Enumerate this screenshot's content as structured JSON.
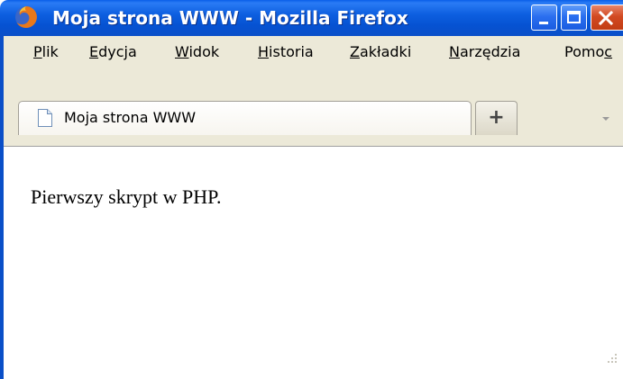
{
  "window": {
    "title": "Moja strona WWW - Mozilla Firefox"
  },
  "title_buttons": {
    "minimize": "minimize-icon",
    "maximize": "maximize-icon",
    "close": "close-icon"
  },
  "menu": {
    "items": [
      {
        "underline": "P",
        "rest": "lik"
      },
      {
        "underline": "E",
        "rest": "dycja"
      },
      {
        "underline": "W",
        "rest": "idok"
      },
      {
        "underline": "H",
        "rest": "istoria"
      },
      {
        "underline": "Z",
        "rest": "akładki"
      },
      {
        "underline": "N",
        "rest": "arzędzia"
      },
      {
        "prefix": "Pomo",
        "underline": "c"
      }
    ]
  },
  "tabs": {
    "active_label": "Moja strona WWW",
    "new_tab_label": "+"
  },
  "page": {
    "text": "Pierwszy skrypt w PHP."
  },
  "colors": {
    "titlebar": "#0a5ee8",
    "chrome": "#ece9d8",
    "close_button": "#d24a22"
  }
}
